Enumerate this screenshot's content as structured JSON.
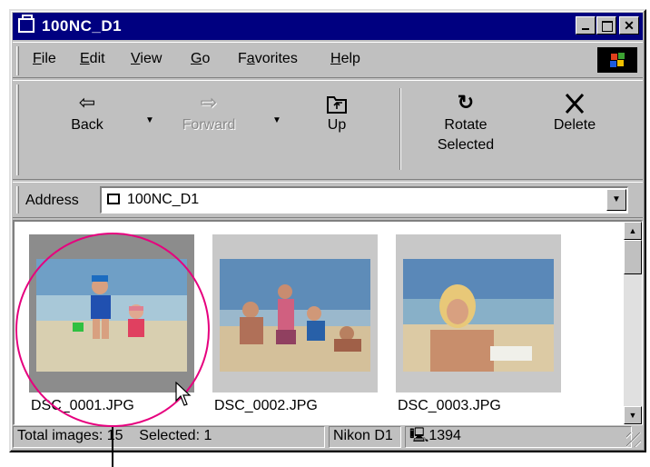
{
  "window": {
    "title": "100NC_D1"
  },
  "menu": {
    "items": [
      "File",
      "Edit",
      "View",
      "Go",
      "Favorites",
      "Help"
    ],
    "underline": [
      "F",
      "E",
      "V",
      "G",
      "a",
      "H"
    ]
  },
  "toolbar": {
    "back_label": "Back",
    "forward_label": "Forward",
    "up_label": "Up",
    "rotate_label_line1": "Rotate",
    "rotate_label_line2": "Selected",
    "delete_label": "Delete"
  },
  "address": {
    "label": "Address",
    "value": "100NC_D1"
  },
  "files": [
    {
      "name": "DSC_0001.JPG",
      "selected": true
    },
    {
      "name": "DSC_0002.JPG",
      "selected": false
    },
    {
      "name": "DSC_0003.JPG",
      "selected": false
    }
  ],
  "status": {
    "total": "Total images: 15",
    "selected": "Selected: 1",
    "camera": "Nikon D1",
    "port": "1394"
  },
  "colors": {
    "titlebar": "#000080",
    "callout": "#e6007e",
    "chrome": "#c0c0c0"
  },
  "icons": {
    "title": "folder-camera-icon",
    "back": "arrow-left-icon",
    "forward": "arrow-right-icon",
    "up": "folder-up-icon",
    "rotate": "rotate-icon",
    "delete": "x-delete-icon",
    "port": "computer-icon"
  }
}
